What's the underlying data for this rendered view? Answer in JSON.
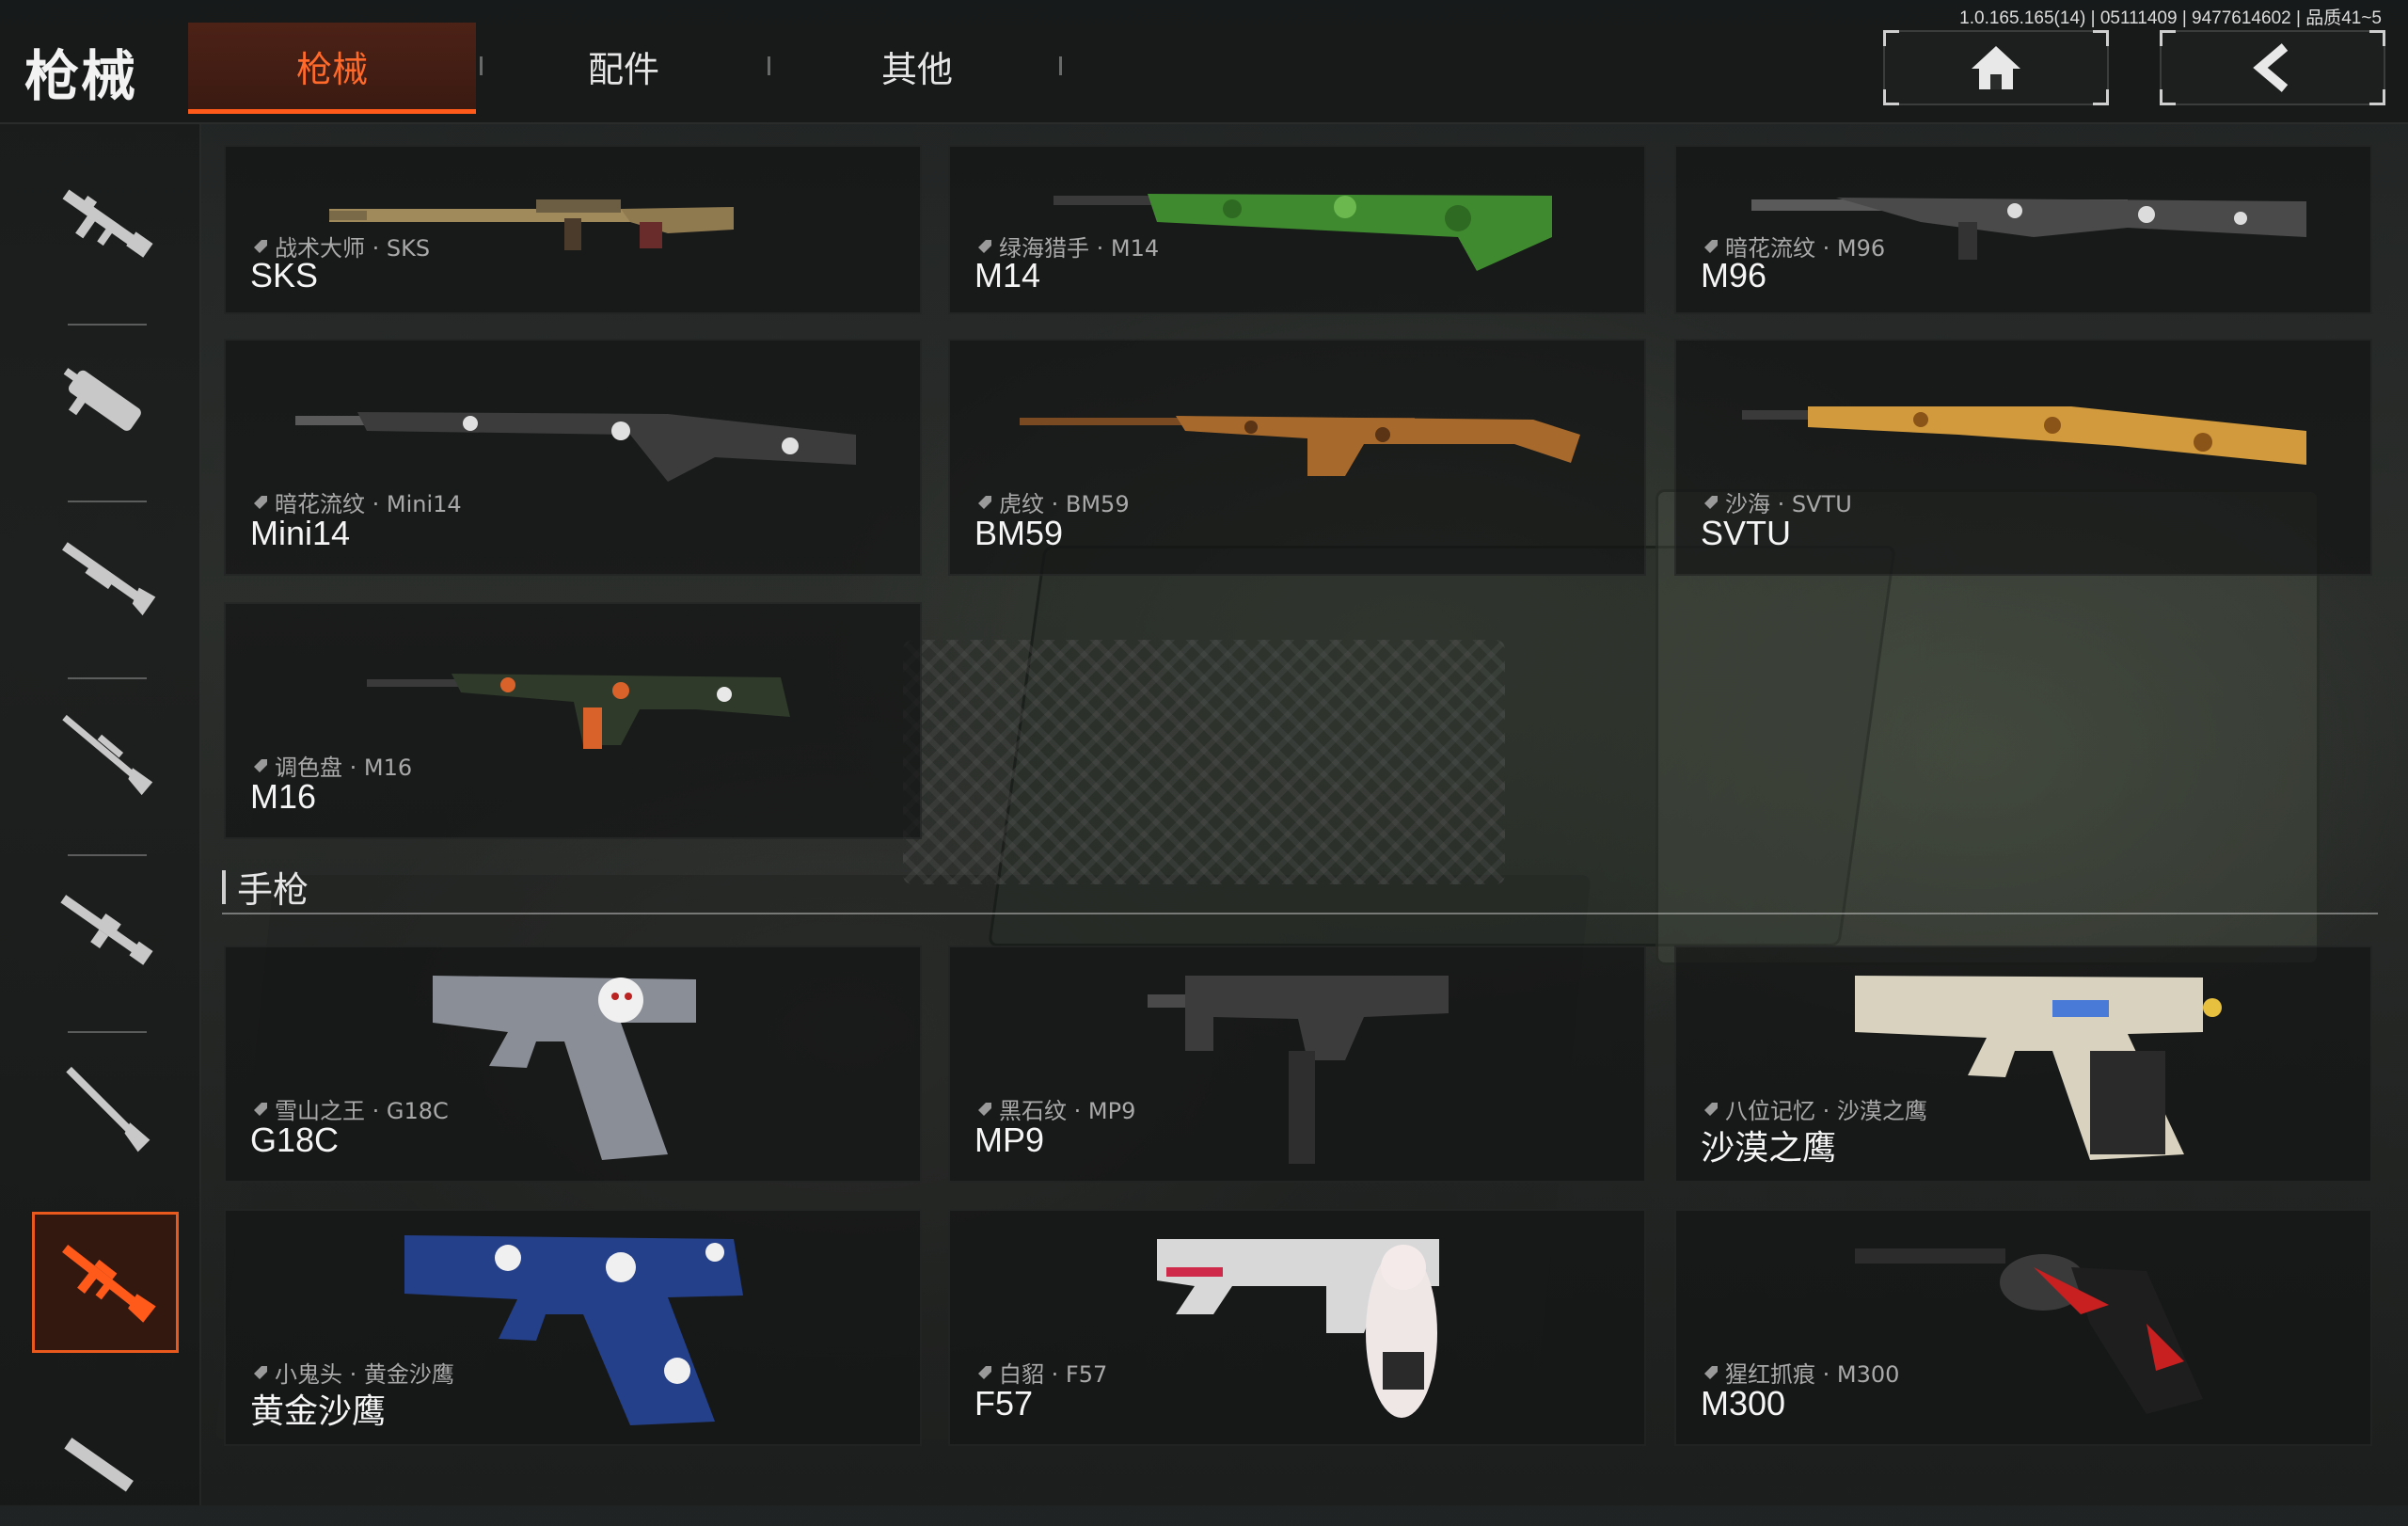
{
  "header": {
    "title": "枪械",
    "tabs": [
      {
        "label": "枪械",
        "active": true
      },
      {
        "label": "配件",
        "active": false
      },
      {
        "label": "其他",
        "active": false
      }
    ],
    "version_text": "1.0.165.165(14) | 05111409 | 9477614602 | 品质41~5",
    "home_icon": "home-icon",
    "back_icon": "chevron-left-icon"
  },
  "sidebar": {
    "categories": [
      {
        "icon": "assault-rifle-icon",
        "active": false
      },
      {
        "icon": "smg-icon",
        "active": false
      },
      {
        "icon": "shotgun-icon",
        "active": false
      },
      {
        "icon": "sniper-rifle-icon",
        "active": false
      },
      {
        "icon": "machine-gun-icon",
        "active": false
      },
      {
        "icon": "bolt-rifle-icon",
        "active": false
      },
      {
        "icon": "marksman-rifle-icon",
        "active": true
      },
      {
        "icon": "pistol-icon",
        "active": false
      }
    ],
    "accent_color": "#e9581c"
  },
  "rifles": [
    {
      "skin": "战术大师 · SKS",
      "name": "SKS"
    },
    {
      "skin": "绿海猎手 · M14",
      "name": "M14"
    },
    {
      "skin": "暗花流纹 · M96",
      "name": "M96"
    },
    {
      "skin": "暗花流纹 · Mini14",
      "name": "Mini14"
    },
    {
      "skin": "虎纹 · BM59",
      "name": "BM59"
    },
    {
      "skin": "沙海 · SVTU",
      "name": "SVTU"
    },
    {
      "skin": "调色盘 · M16",
      "name": "M16"
    }
  ],
  "pistol_section": {
    "title": "手枪"
  },
  "pistols": [
    {
      "skin": "雪山之王 · G18C",
      "name": "G18C"
    },
    {
      "skin": "黑石纹 · MP9",
      "name": "MP9"
    },
    {
      "skin": "八位记忆 · 沙漠之鹰",
      "name": "沙漠之鹰"
    },
    {
      "skin": "小鬼头 · 黄金沙鹰",
      "name": "黄金沙鹰"
    },
    {
      "skin": "白貂 · F57",
      "name": "F57"
    },
    {
      "skin": "猩红抓痕 · M300",
      "name": "M300"
    }
  ]
}
